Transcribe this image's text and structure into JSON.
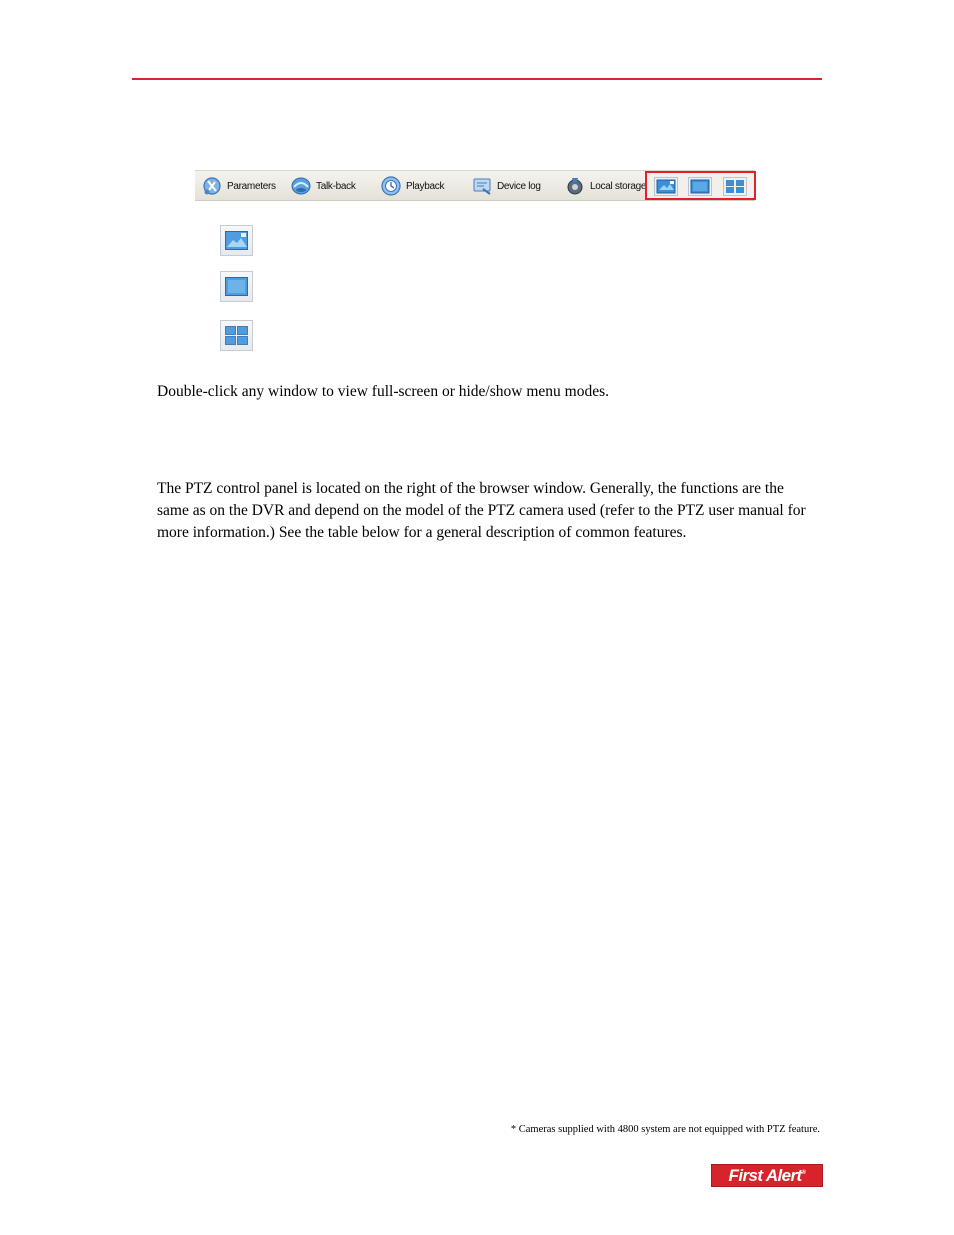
{
  "toolbar": {
    "items": [
      {
        "label": "Parameters",
        "icon": "parameters-icon"
      },
      {
        "label": "Talk-back",
        "icon": "talk-back-icon"
      },
      {
        "label": "Playback",
        "icon": "playback-icon"
      },
      {
        "label": "Device log",
        "icon": "device-log-icon"
      },
      {
        "label": "Local storage",
        "icon": "local-storage-icon"
      }
    ],
    "view_buttons": [
      "fit-window-view-icon",
      "single-view-icon",
      "quad-view-icon"
    ],
    "highlight_color": "#e0202a"
  },
  "body": {
    "paragraph1": "Double-click any window to view full-screen or hide/show menu modes.",
    "paragraph2": "The PTZ control panel is located on the right of the browser window. Generally, the functions are the same as on the DVR and depend on the model of the PTZ camera used (refer to the PTZ user manual for more information.) See the table below for a general description of common features."
  },
  "footnote": "* Cameras supplied with 4800 system are not equipped with PTZ feature.",
  "logo": {
    "text": "First Alert",
    "color": "#d8232a"
  },
  "rule_color": "#e0202a"
}
